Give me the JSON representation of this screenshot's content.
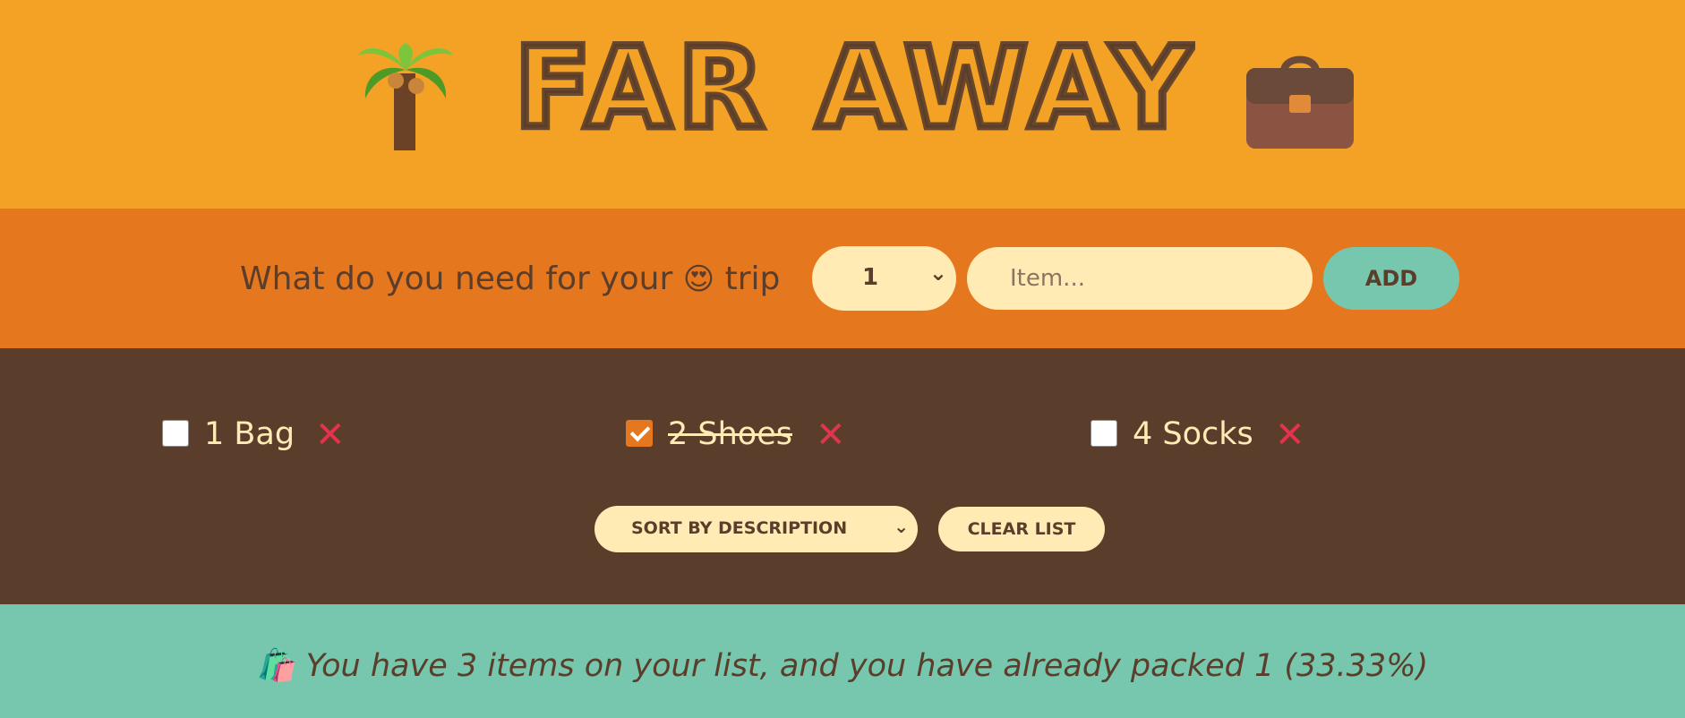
{
  "header": {
    "title": "FAR AWAY",
    "left_icon": "palm-tree-icon",
    "right_icon": "briefcase-icon"
  },
  "form": {
    "question_before": "What do you need for your",
    "question_emoji": "😍",
    "question_after": "trip",
    "quantity_value": "1",
    "item_placeholder": "Item...",
    "add_label": "ADD"
  },
  "items": [
    {
      "label": "1 Bag",
      "packed": false
    },
    {
      "label": "2 Shoes",
      "packed": true
    },
    {
      "label": "4 Socks",
      "packed": false
    }
  ],
  "delete_glyph": "✕",
  "actions": {
    "sort_value": "SORT BY DESCRIPTION",
    "clear_label": "CLEAR LIST"
  },
  "stats": {
    "emoji": "🛍️",
    "text": "You have 3 items on your list, and you have already packed 1 (33.33%)"
  },
  "colors": {
    "header_bg": "#f4a226",
    "form_bg": "#e5771e",
    "list_bg": "#5a3e2b",
    "stats_bg": "#76c7ad",
    "cream": "#ffebb3",
    "delete_red": "#e5334f"
  }
}
